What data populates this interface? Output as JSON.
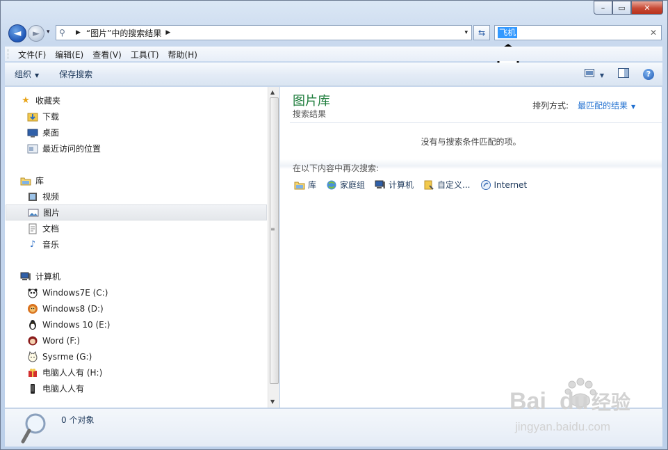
{
  "window": {
    "caption": {
      "minimize": "–",
      "maximize": "▭",
      "close": "✕"
    }
  },
  "address_bar": {
    "back_glyph": "◄",
    "forward_glyph": "►",
    "history_glyph": "▾",
    "search_icon": "⚲",
    "crumb_sep": "▶",
    "path": "“图片”中的搜索结果",
    "path_sep": "▶",
    "dropdown": "▾",
    "refresh_glyph": "⇆"
  },
  "search": {
    "query": "飞机",
    "clear": "✕"
  },
  "menu": [
    "文件(F)",
    "编辑(E)",
    "查看(V)",
    "工具(T)",
    "帮助(H)"
  ],
  "toolbar": {
    "organize": "组织",
    "organize_dd": "▼",
    "save_search": "保存搜索",
    "view_dd": "▼",
    "help": "?"
  },
  "nav": {
    "favorites": {
      "label": "收藏夹",
      "items": [
        "下载",
        "桌面",
        "最近访问的位置"
      ]
    },
    "libraries": {
      "label": "库",
      "items": [
        "视频",
        "图片",
        "文档",
        "音乐"
      ],
      "selected": "图片"
    },
    "computer": {
      "label": "计算机",
      "items": [
        "Windows7E (C:)",
        "Windows8 (D:)",
        "Windows 10 (E:)",
        "Word (F:)",
        "Sysrme (G:)",
        "电脑人人有 (H:)",
        "电脑人人有"
      ]
    }
  },
  "content": {
    "title": "图片库",
    "subtitle": "搜索结果",
    "sort_label": "排列方式:",
    "sort_value": "最匹配的结果",
    "sort_dd": "▼",
    "empty_message": "没有与搜索条件匹配的项。",
    "search_again_label": "在以下内容中再次搜索:",
    "search_again_targets": [
      "库",
      "家庭组",
      "计算机",
      "自定义...",
      "Internet"
    ]
  },
  "details": {
    "status": "0 个对象"
  },
  "watermark": {
    "brand": "Bai",
    "brand2": "du",
    "brand_cn": "经验",
    "url": "jingyan.baidu.com"
  },
  "colors": {
    "library_title": "#1e7d3c",
    "link": "#1f6fd0",
    "selection": "#3399ff"
  }
}
